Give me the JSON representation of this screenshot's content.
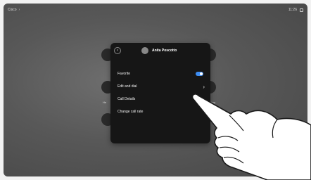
{
  "topbar": {
    "brand": "Cisco",
    "time": "11:26"
  },
  "contact": {
    "name": "Anita Poscotto"
  },
  "menu": [
    {
      "label": "Favorite",
      "control": "toggle",
      "on": true
    },
    {
      "label": "Edit and dial",
      "control": "chevron"
    },
    {
      "label": "Call Details",
      "control": "chevron"
    },
    {
      "label": "Change call rate",
      "control": "none"
    }
  ],
  "background_labels": {
    "left": "He",
    "right": "Sharing"
  },
  "colors": {
    "toggle_on": "#3d8df2",
    "modal_bg": "#161616"
  },
  "icons": {
    "back": "back-arrow-icon",
    "avatar": "avatar",
    "chevron": "chevron-right-icon",
    "square": "screen-icon"
  }
}
